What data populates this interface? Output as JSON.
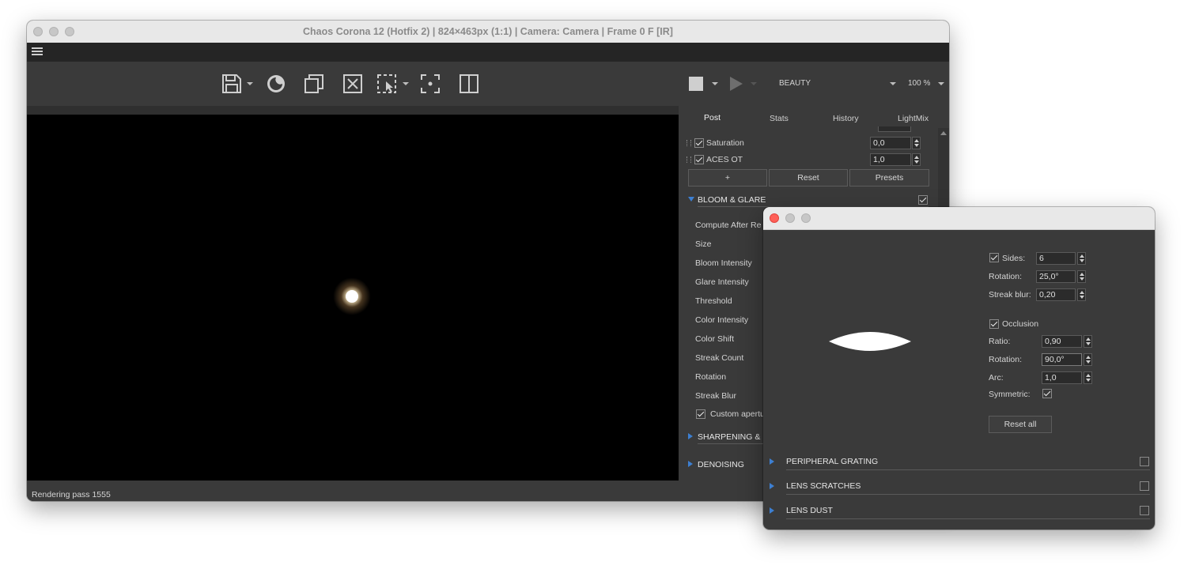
{
  "main_window": {
    "title": "Chaos Corona 12 (Hotfix 2) | 824×463px (1:1) | Camera: Camera | Frame 0 F [IR]",
    "status": "Rendering pass 1555",
    "toolbar_icons": [
      "save-icon",
      "corona-logo-icon",
      "copy-icon",
      "clear-icon",
      "region-select-icon",
      "focus-icon",
      "compare-icon"
    ],
    "render_controls": {
      "channel": "BEAUTY",
      "zoom": "100 %"
    },
    "tabs": [
      "Post",
      "Stats",
      "History",
      "LightMix"
    ],
    "active_tab": "Post",
    "rows": [
      {
        "label": "Saturation",
        "value": "0,0"
      },
      {
        "label": "ACES OT",
        "value": "1,0"
      }
    ],
    "buttons": {
      "add": "+",
      "reset": "Reset",
      "presets": "Presets"
    },
    "bloom_section": "BLOOM & GLARE",
    "bloom_items": [
      "Compute After Re",
      "Size",
      "Bloom Intensity",
      "Glare Intensity",
      "Threshold",
      "Color Intensity",
      "Color Shift",
      "Streak Count",
      "Rotation",
      "Streak Blur"
    ],
    "custom_aperture": "Custom apertu",
    "sharpening_section": "SHARPENING & B",
    "denoising_section": "DENOISING"
  },
  "aperture_dialog": {
    "sides_label": "Sides:",
    "sides_value": "6",
    "rotation_label": "Rotation:",
    "rotation_value": "25,0°",
    "streak_blur_label": "Streak blur:",
    "streak_blur_value": "0,20",
    "occlusion_label": "Occlusion",
    "ratio_label": "Ratio:",
    "ratio_value": "0,90",
    "rotation2_label": "Rotation:",
    "rotation2_value": "90,0°",
    "arc_label": "Arc:",
    "arc_value": "1,0",
    "symmetric_label": "Symmetric:",
    "reset_all": "Reset all",
    "sections": [
      "PERIPHERAL GRATING",
      "LENS SCRATCHES",
      "LENS DUST"
    ]
  }
}
